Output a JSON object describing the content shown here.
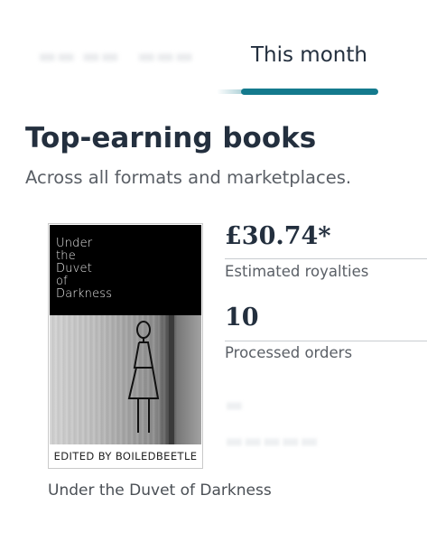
{
  "tabs": {
    "active_label": "This month"
  },
  "section": {
    "title": "Top-earning books",
    "subtitle": "Across all formats and marketplaces."
  },
  "book": {
    "cover_title": "Under\nthe\nDuvet\nof\nDarkness",
    "cover_author": "EDITED BY BOILEDBEETLE",
    "name": "Under the Duvet of Darkness"
  },
  "metrics": [
    {
      "value": "£30.74*",
      "label": "Estimated royalties"
    },
    {
      "value": "10",
      "label": "Processed orders"
    }
  ],
  "colors": {
    "accent": "#147a8d",
    "text_primary": "#232f3e",
    "text_secondary": "#5a5f66"
  }
}
